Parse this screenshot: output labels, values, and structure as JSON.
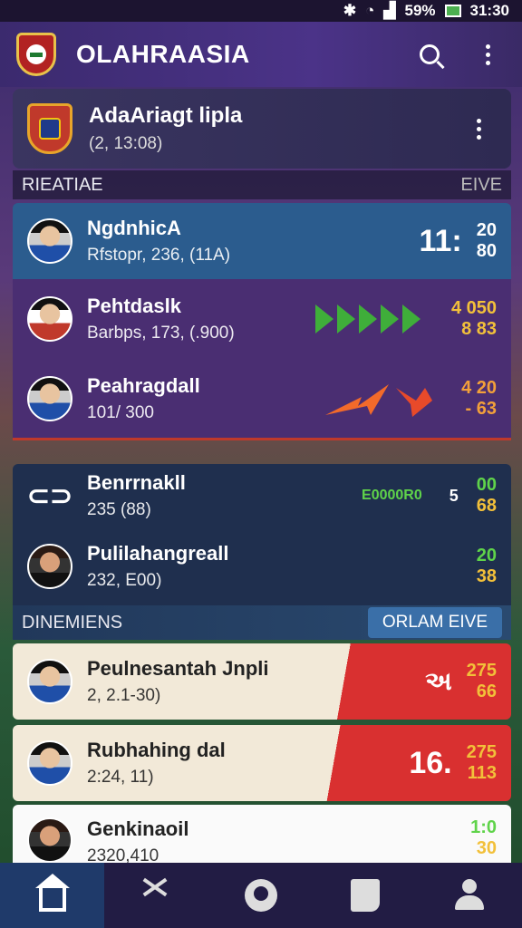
{
  "status": {
    "battery": "59%",
    "time": "31:30"
  },
  "header": {
    "title": "OLAHRAASIA"
  },
  "league": {
    "name": "AdaAriagt lipla",
    "sub": "(‎2, 13:08)"
  },
  "section1": {
    "left": "RIEATIAE",
    "right": "EIVE"
  },
  "live_matches": [
    {
      "name": "NgdnhicA",
      "sub": "Rfstopr, 236, (11A)",
      "big": "11:",
      "top": "20",
      "bottom": "80"
    },
    {
      "name": "Pehtdaslk",
      "sub": "Barbps, 173, (.900)",
      "top": "4  050",
      "bottom": "8  83"
    },
    {
      "name": "Peahragdall",
      "sub": "101/ 300",
      "top": "4  20",
      "bottom": "-  63"
    }
  ],
  "section2_rows": [
    {
      "name": "Benrrnakll",
      "sub": "235 (88)",
      "label": "E0000R0",
      "mid": "5",
      "top": "00",
      "bottom": "68"
    },
    {
      "name": "Pulilahangreall",
      "sub": "232, E00)",
      "top": "20",
      "bottom": "38"
    }
  ],
  "section3": {
    "left": "DINEMIENS",
    "button": "ORLAM EIVE"
  },
  "upcoming": [
    {
      "name": "Peulnesantah Jnpli",
      "sub": "2, 2.1-30)",
      "mid": "અ",
      "top": "275",
      "bottom": "66"
    },
    {
      "name": "Rubhahing dal",
      "sub": "2:24, 11)",
      "big": "16.",
      "top": "275",
      "bottom": "113"
    },
    {
      "name": "Genkinaoil",
      "sub": "2320,410",
      "top": "1:0",
      "bottom": "30"
    }
  ]
}
